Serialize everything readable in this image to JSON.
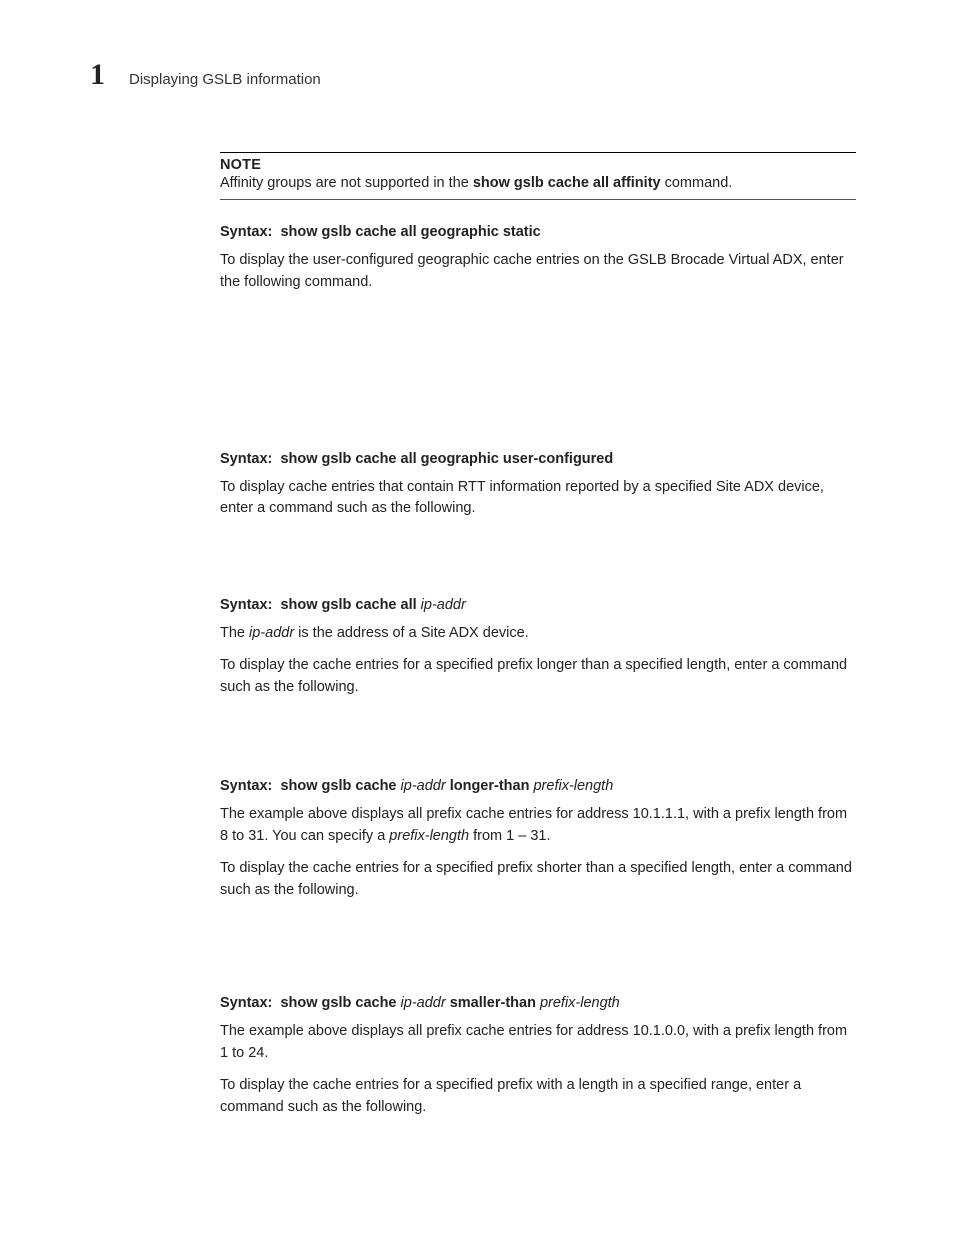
{
  "header": {
    "chapter": "1",
    "section": "Displaying GSLB information"
  },
  "note": {
    "label": "NOTE",
    "prefix": "Affinity groups are not supported in the ",
    "cmd": "show gslb cache all affinity",
    "suffix": " command."
  },
  "s1": {
    "syntax_label": "Syntax:",
    "syntax_cmd": "show gslb cache all geographic static",
    "desc": "To display the user-configured geographic cache entries on the GSLB Brocade Virtual ADX, enter the following command."
  },
  "s2": {
    "syntax_label": "Syntax:",
    "syntax_cmd": "show gslb cache all geographic user-configured",
    "desc": "To display cache entries that contain RTT information reported by a specified Site ADX device, enter a command such as the following."
  },
  "s3": {
    "syntax_label": "Syntax:",
    "syntax_cmd_a": "show gslb cache all ",
    "syntax_cmd_it": "ip-addr",
    "d1a": "The ",
    "d1it": "ip-addr",
    "d1b": " is the address of a Site ADX device.",
    "d2": "To display the cache entries for a specified prefix longer than a specified length, enter a command such as the following."
  },
  "s4": {
    "syntax_label": "Syntax:",
    "syntax_cmd_a": "show gslb cache ",
    "syntax_cmd_it1": "ip-addr",
    "syntax_cmd_b": " longer-than ",
    "syntax_cmd_it2": "prefix-length",
    "d1a": "The example above displays all prefix cache entries for address 10.1.1.1, with a prefix length from 8 to 31. You can specify a ",
    "d1it": "prefix-length",
    "d1b": " from 1 – 31.",
    "d2": "To display the cache entries for a specified prefix shorter than a specified length, enter a command such as the following."
  },
  "s5": {
    "syntax_label": "Syntax:",
    "syntax_cmd_a": "show gslb cache ",
    "syntax_cmd_it1": "ip-addr",
    "syntax_cmd_b": " smaller-than ",
    "syntax_cmd_it2": "prefix-length",
    "d1": "The example above displays all prefix cache entries for address 10.1.0.0, with a prefix length from 1 to 24.",
    "d2": "To display the cache entries for a specified prefix with a length in a specified range, enter a command such as the following."
  }
}
